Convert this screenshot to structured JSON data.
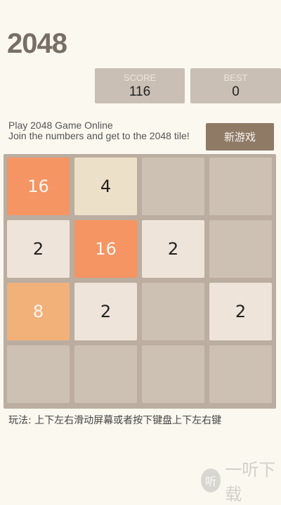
{
  "header": {
    "title": "2048"
  },
  "scores": {
    "score_label": "SCORE",
    "score_value": "116",
    "best_label": "BEST",
    "best_value": "0"
  },
  "intro": {
    "line1": "Play 2048 Game Online",
    "line2": "Join the numbers and get to the 2048 tile!"
  },
  "controls": {
    "new_game_label": "新游戏"
  },
  "board": {
    "rows": [
      [
        "16",
        "4",
        "",
        ""
      ],
      [
        "2",
        "16",
        "2",
        ""
      ],
      [
        "8",
        "2",
        "",
        "2"
      ],
      [
        "",
        "",
        "",
        ""
      ]
    ]
  },
  "instructions": "玩法: 上下左右滑动屏幕或者按下键盘上下左右键",
  "watermark": {
    "badge": "听",
    "text": "一听下载"
  },
  "colors": {
    "background": "#faf8ef",
    "board": "#bbada0",
    "empty_cell": "#cdc1b4",
    "tile_2": "#eee4da",
    "tile_4": "#ede0c8",
    "tile_8": "#f2b179",
    "tile_16": "#f59563",
    "button": "#8f7a66"
  }
}
